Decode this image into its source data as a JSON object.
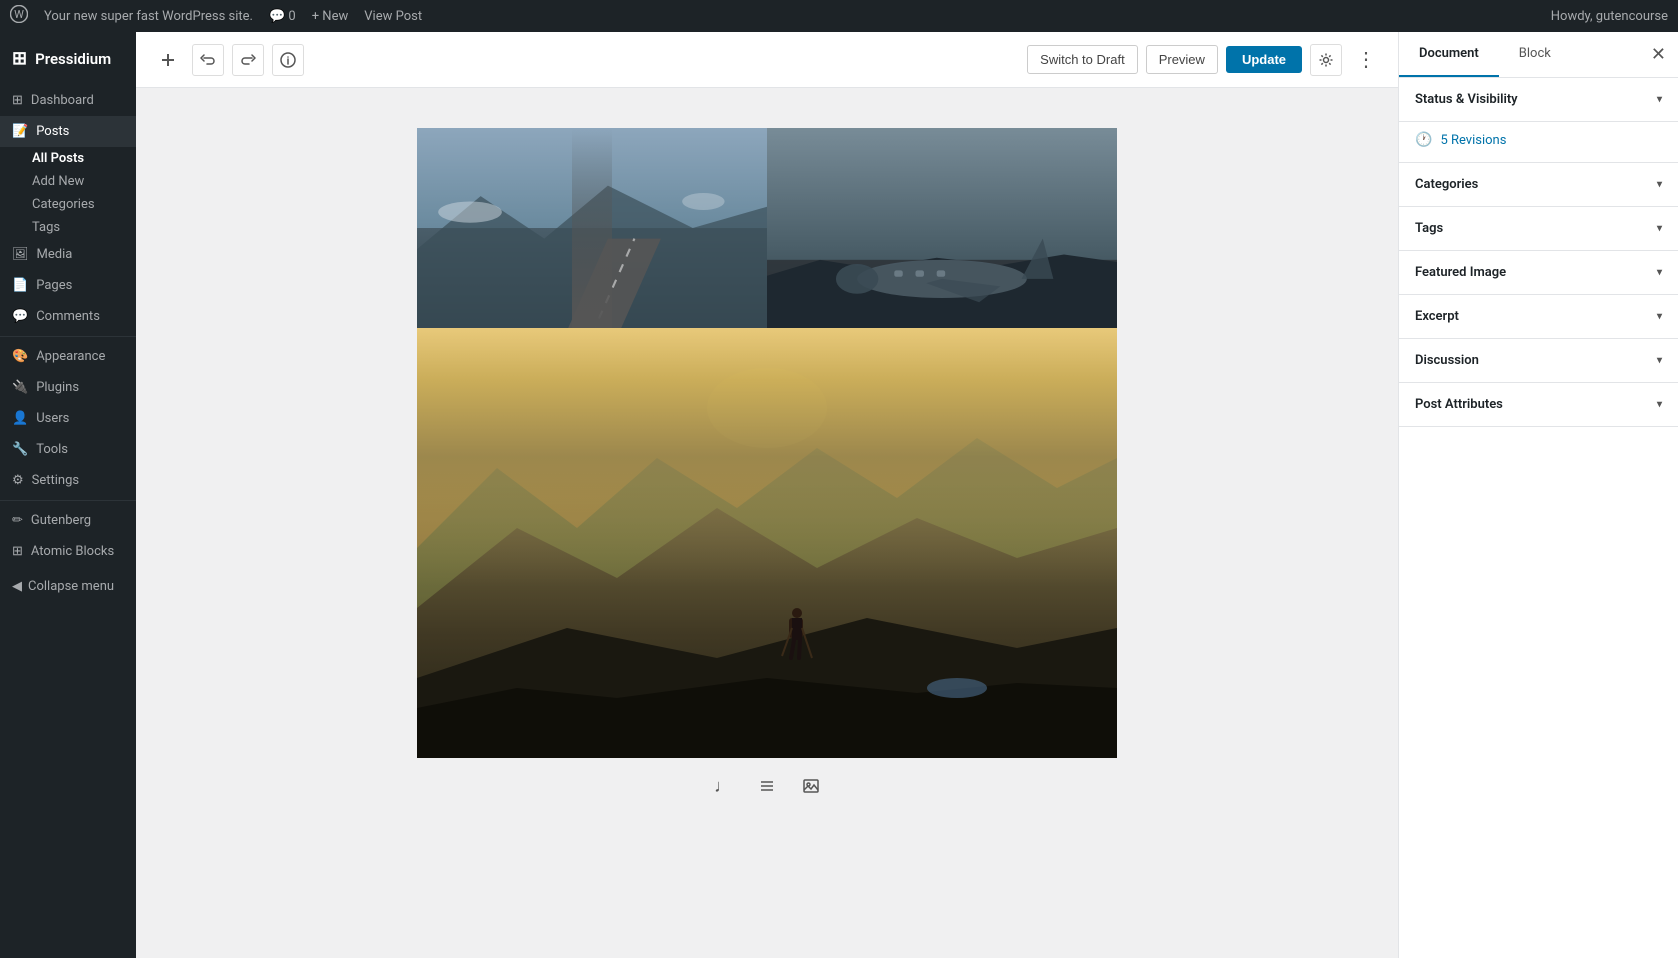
{
  "adminbar": {
    "logo": "⊞",
    "site_name": "Your new super fast WordPress site.",
    "comments_label": "💬 0",
    "new_label": "+ New",
    "view_post_label": "View Post",
    "howdy": "Howdy, gutencourse"
  },
  "sidebar": {
    "brand": "Pressidium",
    "items": [
      {
        "id": "dashboard",
        "label": "Dashboard",
        "icon": "⊞"
      },
      {
        "id": "posts",
        "label": "Posts",
        "icon": "📝",
        "active": true
      },
      {
        "id": "media",
        "label": "Media",
        "icon": "🖼"
      },
      {
        "id": "pages",
        "label": "Pages",
        "icon": "📄"
      },
      {
        "id": "comments",
        "label": "Comments",
        "icon": "💬"
      },
      {
        "id": "appearance",
        "label": "Appearance",
        "icon": "🎨"
      },
      {
        "id": "plugins",
        "label": "Plugins",
        "icon": "🔌"
      },
      {
        "id": "users",
        "label": "Users",
        "icon": "👤"
      },
      {
        "id": "tools",
        "label": "Tools",
        "icon": "🔧"
      },
      {
        "id": "settings",
        "label": "Settings",
        "icon": "⚙"
      },
      {
        "id": "gutenberg",
        "label": "Gutenberg",
        "icon": "✏"
      },
      {
        "id": "atomic-blocks",
        "label": "Atomic Blocks",
        "icon": "⊞"
      }
    ],
    "sub_items": [
      {
        "id": "all-posts",
        "label": "All Posts",
        "active": true
      },
      {
        "id": "add-new",
        "label": "Add New"
      },
      {
        "id": "categories",
        "label": "Categories"
      },
      {
        "id": "tags",
        "label": "Tags"
      }
    ],
    "collapse_label": "Collapse menu"
  },
  "toolbar": {
    "add_block_label": "+",
    "undo_label": "↩",
    "redo_label": "↪",
    "info_label": "ℹ",
    "switch_draft_label": "Switch to Draft",
    "preview_label": "Preview",
    "update_label": "Update",
    "settings_label": "⚙",
    "more_label": "⋮"
  },
  "right_panel": {
    "tabs": [
      {
        "id": "document",
        "label": "Document",
        "active": true
      },
      {
        "id": "block",
        "label": "Block"
      }
    ],
    "close_label": "✕",
    "sections": [
      {
        "id": "status-visibility",
        "label": "Status & Visibility",
        "expanded": true
      },
      {
        "id": "revisions",
        "label": "Revisions",
        "count": "5 Revisions",
        "expanded": true
      },
      {
        "id": "categories",
        "label": "Categories",
        "expanded": false
      },
      {
        "id": "tags",
        "label": "Tags",
        "expanded": false
      },
      {
        "id": "featured-image",
        "label": "Featured Image",
        "expanded": false
      },
      {
        "id": "excerpt",
        "label": "Excerpt",
        "expanded": false
      },
      {
        "id": "discussion",
        "label": "Discussion",
        "expanded": false
      },
      {
        "id": "post-attributes",
        "label": "Post Attributes",
        "expanded": false
      }
    ]
  },
  "editor": {
    "bottom_icons": [
      {
        "id": "audio",
        "icon": "♩",
        "label": "Audio block"
      },
      {
        "id": "list",
        "icon": "≡",
        "label": "List block"
      },
      {
        "id": "image",
        "icon": "▣",
        "label": "Image block"
      }
    ]
  }
}
